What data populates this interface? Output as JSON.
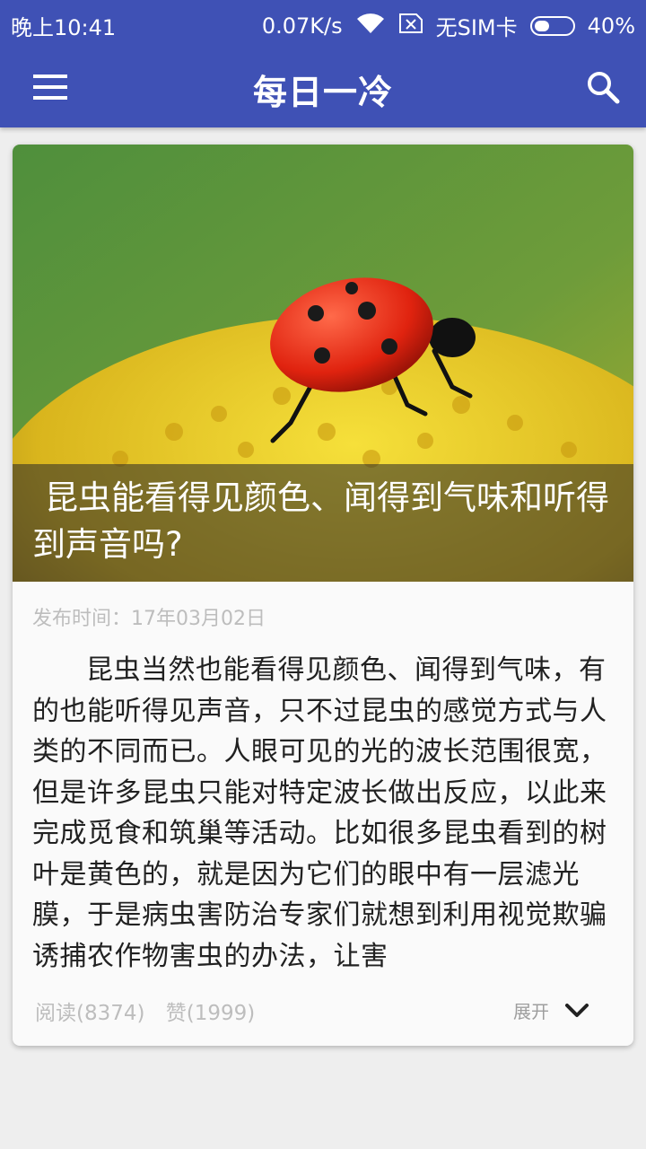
{
  "status_bar": {
    "time": "晚上10:41",
    "network_speed": "0.07K/s",
    "sim_text": "无SIM卡",
    "battery_text": "40%",
    "battery_level": 0.4,
    "icons": [
      "wifi-icon",
      "no-sim-icon",
      "battery-icon"
    ]
  },
  "toolbar": {
    "title": "每日一冷",
    "left_icon": "menu-icon",
    "right_icon": "search-icon"
  },
  "colors": {
    "primary": "#3f51b5",
    "background": "#eeeeee",
    "card": "#fafafa",
    "muted_text": "#bdbdbd"
  },
  "card": {
    "image_icon": "ladybug-on-flower-image",
    "title": "昆虫能看得见颜色、闻得到气味和听得到声音吗?",
    "publish_time": "发布时间：17年03月02日",
    "body": "昆虫当然也能看得见颜色、闻得到气味，有的也能听得见声音，只不过昆虫的感觉方式与人类的不同而已。人眼可见的光的波长范围很宽，但是许多昆虫只能对特定波长做出反应，以此来完成觅食和筑巢等活动。比如很多昆虫看到的树叶是黄色的，就是因为它们的眼中有一层滤光膜，于是病虫害防治专家们就想到利用视觉欺骗诱捕农作物害虫的办法，让害",
    "reads": "阅读(8374)",
    "likes": "赞(1999)",
    "expand_label": "展开",
    "expand_icon": "chevron-down-icon"
  }
}
